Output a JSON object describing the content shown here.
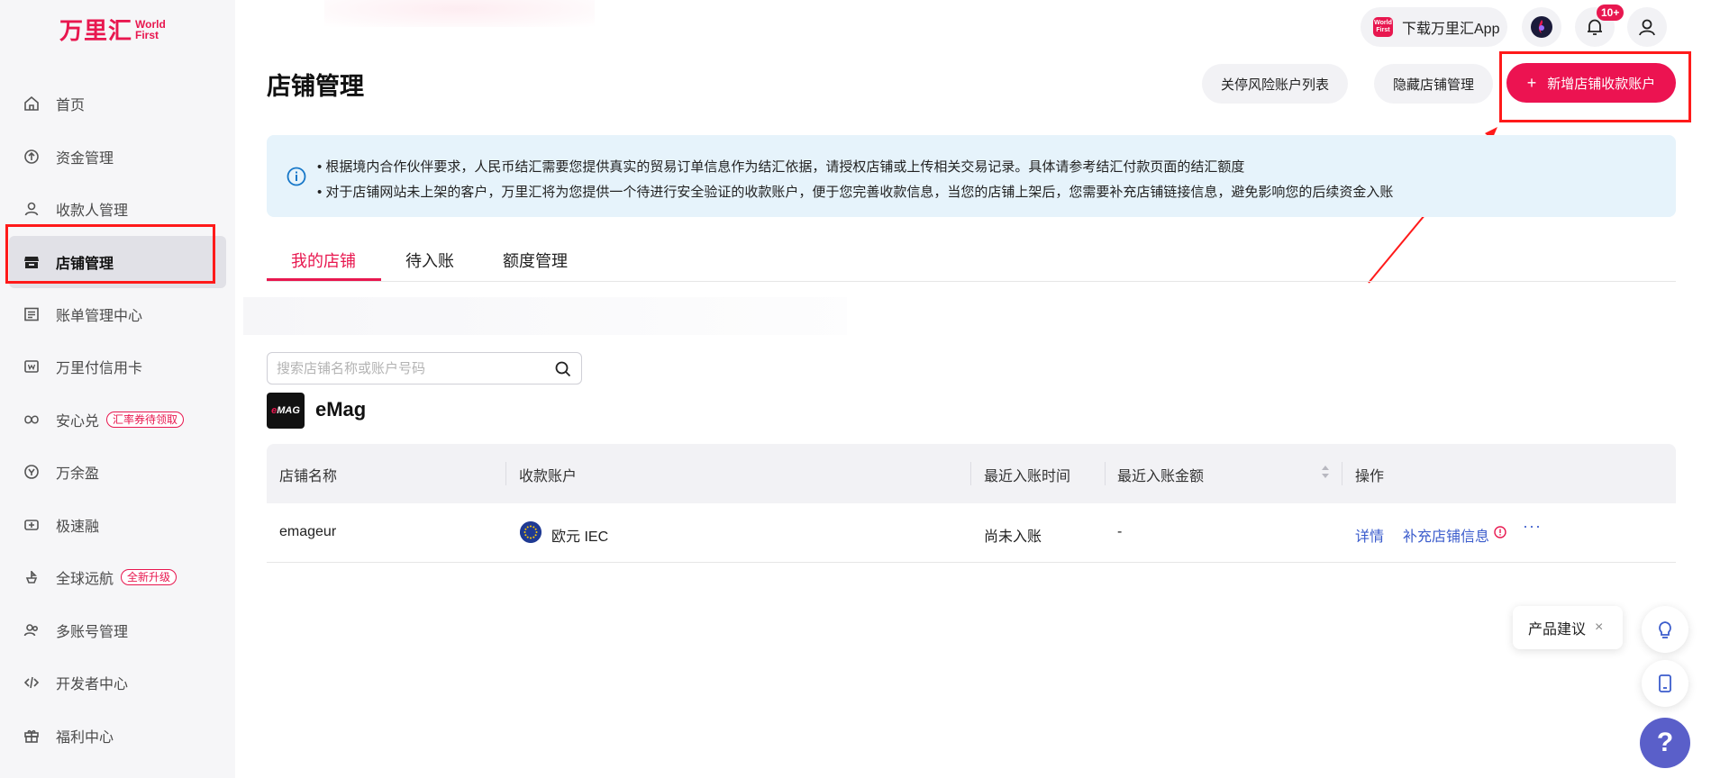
{
  "brand": {
    "name_cn": "万里汇",
    "name_en_1": "World",
    "name_en_2": "First"
  },
  "sidebar": {
    "items": [
      {
        "label": "首页",
        "icon": "home-icon"
      },
      {
        "label": "资金管理",
        "icon": "fund-icon"
      },
      {
        "label": "收款人管理",
        "icon": "payee-icon"
      },
      {
        "label": "店铺管理",
        "icon": "store-icon",
        "active": true
      },
      {
        "label": "账单管理中心",
        "icon": "bill-icon"
      },
      {
        "label": "万里付信用卡",
        "icon": "card-icon"
      },
      {
        "label": "安心兑",
        "icon": "exchange-icon",
        "tag": "汇率券待领取"
      },
      {
        "label": "万余盈",
        "icon": "yield-icon"
      },
      {
        "label": "极速融",
        "icon": "finance-icon"
      },
      {
        "label": "全球远航",
        "icon": "voyage-icon",
        "tag": "全新升级"
      },
      {
        "label": "多账号管理",
        "icon": "multi-account-icon"
      },
      {
        "label": "开发者中心",
        "icon": "developer-icon"
      },
      {
        "label": "福利中心",
        "icon": "gift-icon"
      }
    ]
  },
  "topbar": {
    "app_download": "下载万里汇App",
    "app_icon_text_1": "World",
    "app_icon_text_2": "First",
    "notification_badge": "10+"
  },
  "header": {
    "title": "店铺管理",
    "btn_close_risk": "关停风险账户列表",
    "btn_hide_store": "隐藏店铺管理",
    "btn_add_account": "新增店铺收款账户",
    "btn_add_plus": "+"
  },
  "notice": {
    "line1": "• 根据境内合作伙伴要求，人民币结汇需要您提供真实的贸易订单信息作为结汇依据，请授权店铺或上传相关交易记录。具体请参考结汇付款页面的结汇额度",
    "line2": "• 对于店铺网站未上架的客户，万里汇将为您提供一个待进行安全验证的收款账户，便于您完善收款信息，当您的店铺上架后，您需要补充店铺链接信息，避免影响您的后续资金入账"
  },
  "tabs": [
    {
      "label": "我的店铺",
      "active": true
    },
    {
      "label": "待入账"
    },
    {
      "label": "额度管理"
    }
  ],
  "search": {
    "placeholder": "搜索店铺名称或账户号码",
    "value": ""
  },
  "store": {
    "logo_text": "eMAG",
    "name": "eMag"
  },
  "table": {
    "headers": [
      "店铺名称",
      "收款账户",
      "最近入账时间",
      "最近入账金额",
      "操作"
    ],
    "rows": [
      {
        "store": "emageur",
        "account": "欧元 IEC",
        "last_time": "尚未入账",
        "last_amount": "-",
        "action_detail": "详情",
        "action_supplement": "补充店铺信息",
        "action_more": "···"
      }
    ]
  },
  "floating": {
    "suggest": "产品建议",
    "suggest_close": "×",
    "help": "?"
  },
  "colors": {
    "brand": "#e8174f",
    "primary_button": "#ec1351",
    "link": "#3b5ccc",
    "highlight_box": "#ff1a1a",
    "notice_bg": "#e6f3fb",
    "help_button": "#5a5fc9"
  }
}
